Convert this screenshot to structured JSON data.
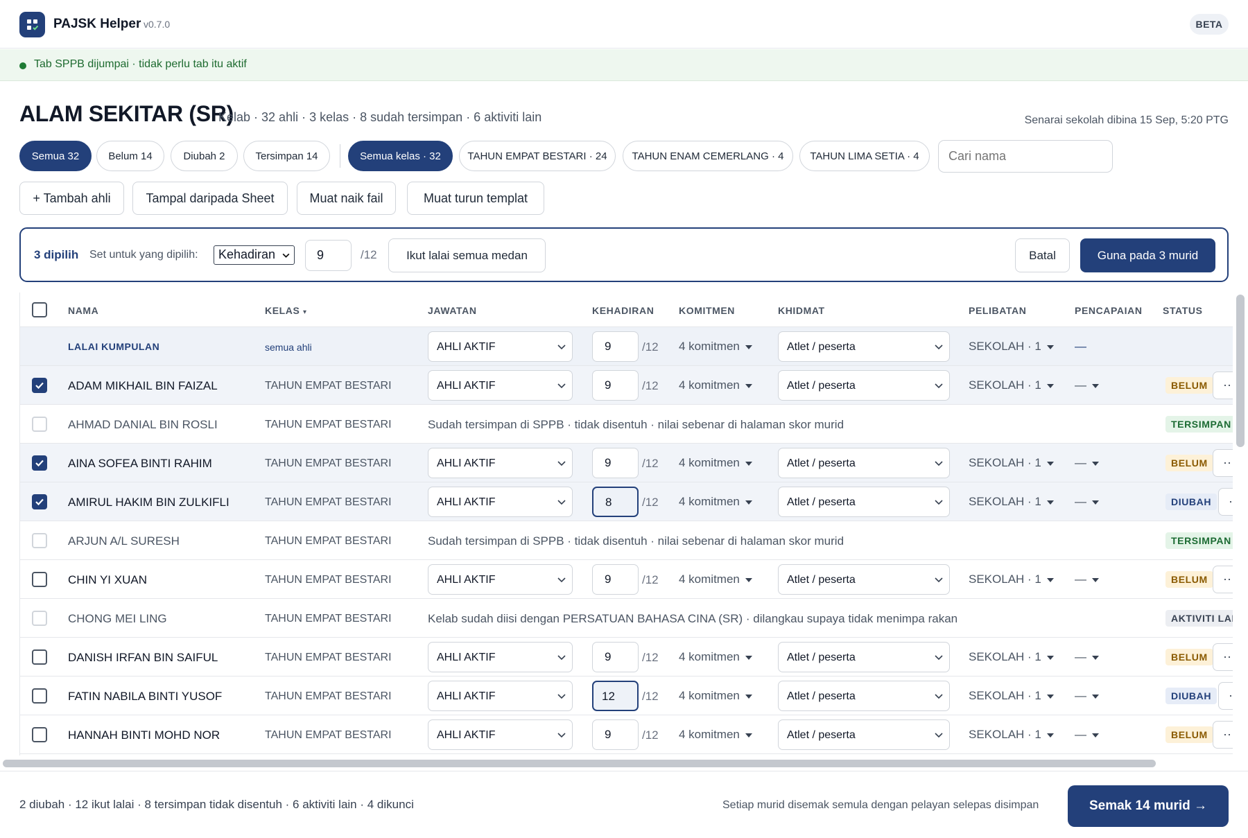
{
  "app": {
    "name": "PAJSK Helper",
    "version": "v0.7.0",
    "badge": "BETA"
  },
  "notice": {
    "text": "Tab SPPB dijumpai · tidak perlu tab itu aktif"
  },
  "header": {
    "title": "ALAM SEKITAR (SR)",
    "subtitle": "Kelab · 32 ahli · 3 kelas · 8 sudah tersimpan · 6 aktiviti lain",
    "built": "Senarai sekolah dibina 15 Sep, 5:20 PTG"
  },
  "filters": {
    "status": [
      "Semua 32",
      "Belum 14",
      "Diubah 2",
      "Tersimpan 14"
    ],
    "kelas": [
      "Semua kelas · 32",
      "TAHUN EMPAT BESTARI · 24",
      "TAHUN ENAM CEMERLANG · 4",
      "TAHUN LIMA SETIA · 4"
    ],
    "search_placeholder": "Cari nama"
  },
  "actions": [
    "+ Tambah ahli",
    "Tampal daripada Sheet",
    "Muat naik fail",
    "Muat turun templat"
  ],
  "bulk": {
    "selected": "3 dipilih",
    "set_label": "Set untuk yang dipilih:",
    "field": "Kehadiran",
    "value": "9",
    "max": "/12",
    "reset": "Ikut lalai semua medan",
    "cancel": "Batal",
    "apply": "Guna pada 3 murid"
  },
  "columns": [
    "NAMA",
    "KELAS",
    "JAWATAN",
    "KEHADIRAN",
    "KOMITMEN",
    "KHIDMAT",
    "PELIBATAN",
    "PENCAPAIAN",
    "STATUS"
  ],
  "sort_indicator": "▾",
  "default_row": {
    "name": "LALAI KUMPULAN",
    "kelas": "semua ahli",
    "jawatan": "AHLI AKTIF",
    "hadir": "9",
    "max": "/12",
    "komitmen": "4 komitmen",
    "khidmat": "Atlet / peserta",
    "pelibatan": "SEKOLAH · 1",
    "pencapaian": "—"
  },
  "rows": [
    {
      "name": "ADAM MIKHAIL BIN FAIZAL",
      "kelas": "TAHUN EMPAT BESTARI",
      "jawatan": "AHLI AKTIF",
      "hadir": "9",
      "max": "/12",
      "komitmen": "4 komitmen",
      "khidmat": "Atlet / peserta",
      "pelibatan": "SEKOLAH · 1",
      "pencapaian": "—",
      "status": "BELUM",
      "more": "···"
    },
    {
      "name": "AHMAD DANIAL BIN ROSLI",
      "kelas": "TAHUN EMPAT BESTARI",
      "note": "Sudah tersimpan di SPPB · tidak disentuh · nilai sebenar di halaman skor murid",
      "status": "TERSIMPAN"
    },
    {
      "name": "AINA SOFEA BINTI RAHIM",
      "kelas": "TAHUN EMPAT BESTARI",
      "jawatan": "AHLI AKTIF",
      "hadir": "9",
      "max": "/12",
      "komitmen": "4 komitmen",
      "khidmat": "Atlet / peserta",
      "pelibatan": "SEKOLAH · 1",
      "pencapaian": "—",
      "status": "BELUM",
      "more": "···"
    },
    {
      "name": "AMIRUL HAKIM BIN ZULKIFLI",
      "kelas": "TAHUN EMPAT BESTARI",
      "jawatan": "AHLI AKTIF",
      "hadir": "8",
      "max": "/12",
      "komitmen": "4 komitmen",
      "khidmat": "Atlet / peserta",
      "pelibatan": "SEKOLAH · 1",
      "pencapaian": "—",
      "status": "DIUBAH",
      "more": "···"
    },
    {
      "name": "ARJUN A/L SURESH",
      "kelas": "TAHUN EMPAT BESTARI",
      "note": "Sudah tersimpan di SPPB · tidak disentuh · nilai sebenar di halaman skor murid",
      "status": "TERSIMPAN"
    },
    {
      "name": "CHIN YI XUAN",
      "kelas": "TAHUN EMPAT BESTARI",
      "jawatan": "AHLI AKTIF",
      "hadir": "9",
      "max": "/12",
      "komitmen": "4 komitmen",
      "khidmat": "Atlet / peserta",
      "pelibatan": "SEKOLAH · 1",
      "pencapaian": "—",
      "status": "BELUM",
      "more": "···"
    },
    {
      "name": "CHONG MEI LING",
      "kelas": "TAHUN EMPAT BESTARI",
      "note": "Kelab sudah diisi dengan PERSATUAN BAHASA CINA (SR) · dilangkau supaya tidak menimpa rakan",
      "status": "AKTIVITI LAI"
    },
    {
      "name": "DANISH IRFAN BIN SAIFUL",
      "kelas": "TAHUN EMPAT BESTARI",
      "jawatan": "AHLI AKTIF",
      "hadir": "9",
      "max": "/12",
      "komitmen": "4 komitmen",
      "khidmat": "Atlet / peserta",
      "pelibatan": "SEKOLAH · 1",
      "pencapaian": "—",
      "status": "BELUM",
      "more": "···"
    },
    {
      "name": "FATIN NABILA BINTI YUSOF",
      "kelas": "TAHUN EMPAT BESTARI",
      "jawatan": "AHLI AKTIF",
      "hadir": "12",
      "max": "/12",
      "komitmen": "4 komitmen",
      "khidmat": "Atlet / peserta",
      "pelibatan": "SEKOLAH · 1",
      "pencapaian": "—",
      "status": "DIUBAH",
      "more": "···"
    },
    {
      "name": "HANNAH BINTI MOHD NOR",
      "kelas": "TAHUN EMPAT BESTARI",
      "jawatan": "AHLI AKTIF",
      "hadir": "9",
      "max": "/12",
      "komitmen": "4 komitmen",
      "khidmat": "Atlet / peserta",
      "pelibatan": "SEKOLAH · 1",
      "pencapaian": "—",
      "status": "BELUM",
      "more": "···"
    }
  ],
  "footer": {
    "summary": "2 diubah · 12 ikut lalai · 8 tersimpan tidak disentuh · 6 aktiviti lain · 4 dikunci",
    "hint": "Setiap murid disemak semula dengan pelayan selepas disimpan",
    "primary": "Semak 14 murid →"
  },
  "colors": {
    "accent": "#23407a",
    "notice_bg": "#eef7ef",
    "belum": "#8a5a00",
    "tersimpan": "#1c6b33"
  }
}
